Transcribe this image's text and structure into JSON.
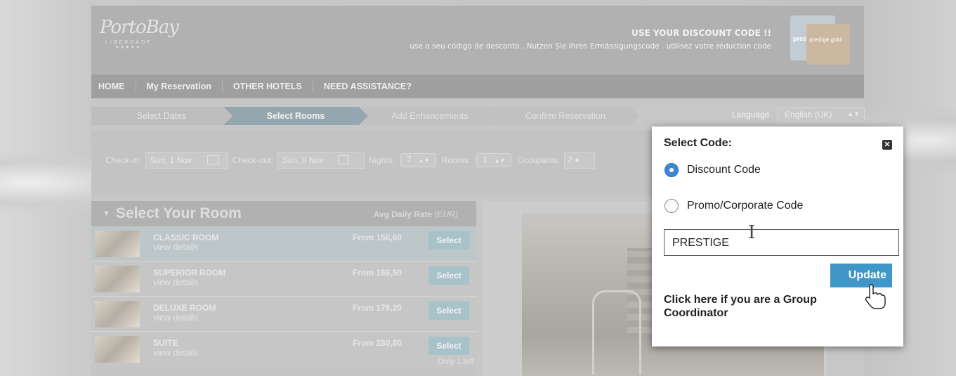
{
  "header": {
    "logo_script": "PortoBay",
    "logo_sub": "LIBERDADE",
    "logo_stars": "★★★★★",
    "promo_title": "USE YOUR DISCOUNT CODE !!",
    "promo_sub": "use o seu código de desconto . Nutzen Sie Ihren Ermässigungscode . utilisez votre réduction code",
    "card_1": "pres",
    "card_2": "prestige gold"
  },
  "nav": {
    "items": [
      "HOME",
      "My Reservation",
      "OTHER HOTELS",
      "NEED ASSISTANCE?"
    ]
  },
  "steps": {
    "items": [
      "Select Dates",
      "Select Rooms",
      "Add Enhancements",
      "Confirm Reservation"
    ],
    "active_index": 1
  },
  "language": {
    "label": "Language",
    "value": "English (UK)"
  },
  "search": {
    "checkin_label": "Check-in:",
    "checkin_value": "Sun, 1 Nov",
    "checkout_label": "Check-out:",
    "checkout_value": "Sun, 8 Nov",
    "nights_label": "Nights:",
    "nights_value": "7",
    "rooms_label": "Rooms:",
    "rooms_value": "1",
    "occupants_label": "Occupants:",
    "occupants_value": "2"
  },
  "rooms_panel": {
    "title": "Select Your Room",
    "rate_label": "Avg Daily Rate",
    "rate_currency": "(EUR)",
    "select_label": "Select",
    "details_label": "view details",
    "rooms": [
      {
        "name": "CLASSIC ROOM",
        "price": "From  156,60"
      },
      {
        "name": "SUPERIOR ROOM",
        "price": "From  166,50"
      },
      {
        "name": "DELUXE ROOM",
        "price": "From  178,20"
      },
      {
        "name": "SUITE",
        "price": "From  280,80",
        "note": "Only 1 left"
      }
    ]
  },
  "modal": {
    "title": "Select Code:",
    "close_glyph": "✕",
    "option_discount": "Discount Code",
    "option_promo": "Promo/Corporate Code",
    "selected": "discount",
    "code_value": "PRESTIGE",
    "update_label": "Update",
    "group_link": "Click here if you are a Group Coordinator"
  },
  "colors": {
    "accent_blue": "#3e97c7",
    "radio_selected": "#3c87d8",
    "overlay_grey": "#c4c4c4"
  }
}
